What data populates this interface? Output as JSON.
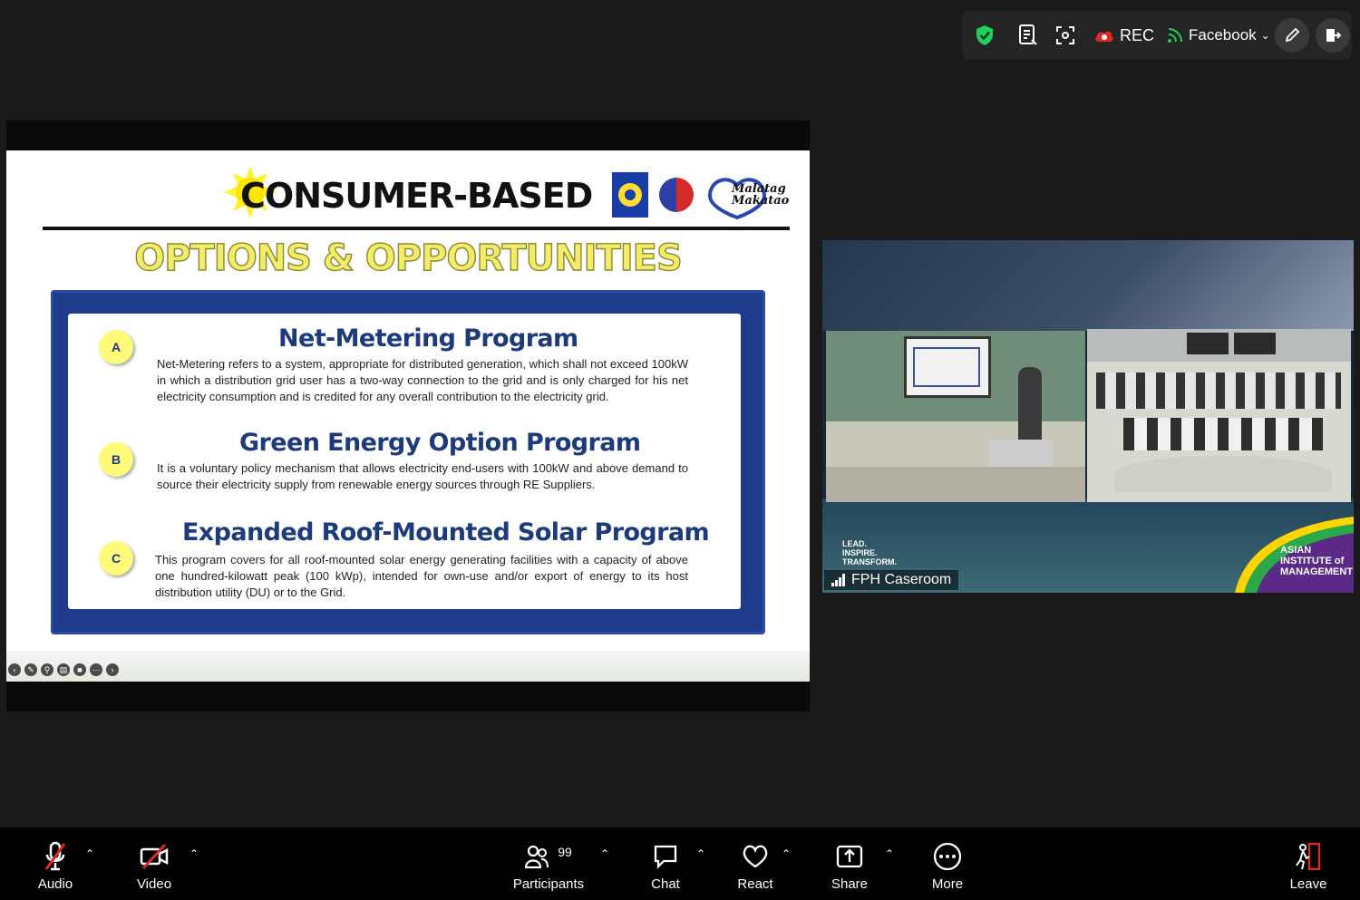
{
  "topbar": {
    "rec_label": "REC",
    "stream_label": "Facebook"
  },
  "slide": {
    "title": "CONSUMER-BASED",
    "subtitle": "OPTIONS & OPPORTUNITIES",
    "logo_text": "Malatag Makatao",
    "programs": [
      {
        "badge": "A",
        "heading": "Net-Metering Program",
        "text": "Net-Metering refers to a system, appropriate for distributed generation, which shall not exceed 100kW in which a distribution grid user has a two-way connection to the grid and is only charged for his net electricity consumption and is credited for any overall contribution to the electricity grid."
      },
      {
        "badge": "B",
        "heading": "Green Energy Option Program",
        "text": "It is a voluntary policy mechanism that allows electricity end-users with 100kW and above demand to source their electricity supply from renewable energy sources through RE Suppliers."
      },
      {
        "badge": "C",
        "heading": "Expanded Roof-Mounted Solar Program",
        "text": "This program covers for all roof-mounted solar energy generating facilities with a capacity of above one hundred-kilowatt peak (100 kWp), intended for own-use and/or export of energy to its host distribution utility (DU) or to the Grid."
      }
    ]
  },
  "video": {
    "tagline": [
      "LEAD.",
      "INSPIRE.",
      "TRANSFORM."
    ],
    "participant_name": "FPH Caseroom",
    "institute": [
      "ASIAN",
      "INSTITUTE of",
      "MANAGEMENT"
    ]
  },
  "bottombar": {
    "audio": "Audio",
    "video": "Video",
    "participants": "Participants",
    "participants_count": "99",
    "chat": "Chat",
    "react": "React",
    "share": "Share",
    "more": "More",
    "leave": "Leave"
  },
  "colors": {
    "background": "#1a1a1a",
    "shield": "#1fd15a",
    "rec": "#e02828",
    "leave": "#e02828",
    "slide_blue": "#1f3c8c",
    "slide_yellow": "#f3ec6a"
  }
}
